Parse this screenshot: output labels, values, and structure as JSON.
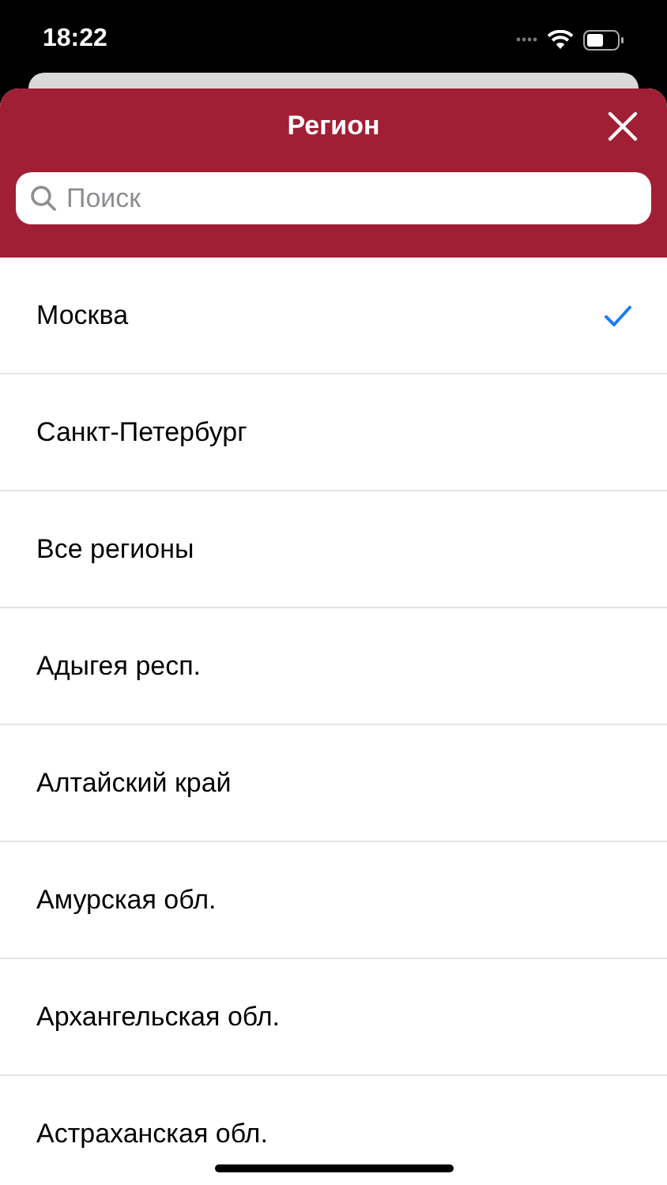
{
  "status_bar": {
    "time": "18:22"
  },
  "sheet": {
    "title": "Регион"
  },
  "search": {
    "placeholder": "Поиск"
  },
  "regions": [
    {
      "name": "Москва",
      "selected": true
    },
    {
      "name": "Санкт-Петербург",
      "selected": false
    },
    {
      "name": "Все регионы",
      "selected": false
    },
    {
      "name": "Адыгея респ.",
      "selected": false
    },
    {
      "name": "Алтайский край",
      "selected": false
    },
    {
      "name": "Амурская обл.",
      "selected": false
    },
    {
      "name": "Архангельская обл.",
      "selected": false
    },
    {
      "name": "Астраханская обл.",
      "selected": false
    }
  ]
}
